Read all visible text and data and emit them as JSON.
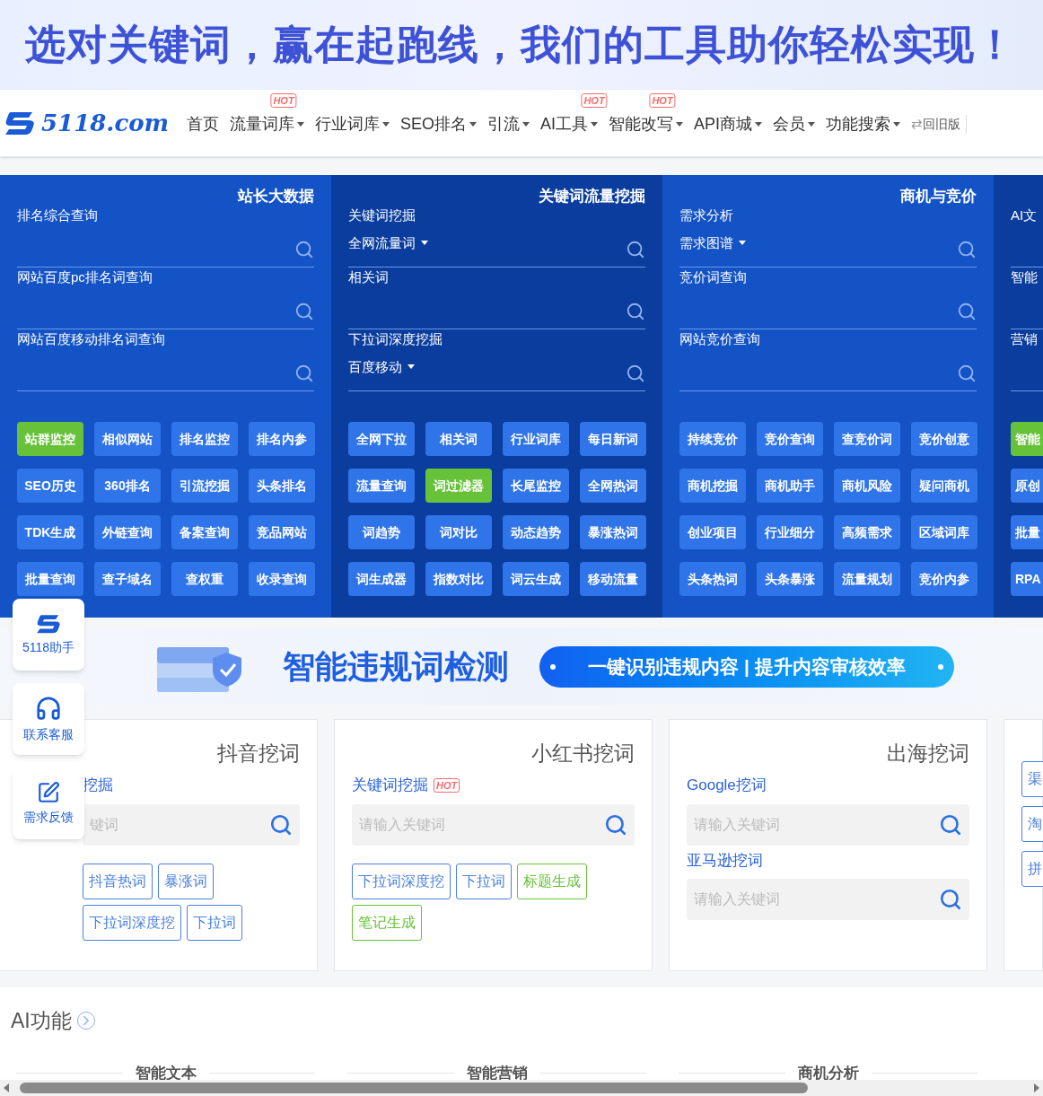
{
  "top_banner": {
    "headline": "选对关键词，赢在起跑线，我们的工具助你轻松实现！"
  },
  "nav": {
    "logo": "5118.com",
    "items": [
      {
        "label": "首页",
        "dropdown": false
      },
      {
        "label": "流量词库",
        "dropdown": true,
        "badge": "HOT"
      },
      {
        "label": "行业词库",
        "dropdown": true
      },
      {
        "label": "SEO排名",
        "dropdown": true
      },
      {
        "label": "引流",
        "dropdown": true
      },
      {
        "label": "AI工具",
        "dropdown": true,
        "badge": "HOT"
      },
      {
        "label": "智能改写",
        "dropdown": true,
        "badge": "HOT"
      },
      {
        "label": "API商城",
        "dropdown": true
      },
      {
        "label": "会员",
        "dropdown": true
      },
      {
        "label": "功能搜索",
        "dropdown": true
      }
    ],
    "switch_icon": "⇄",
    "old_version": "回旧版"
  },
  "tool_panel": {
    "columns": [
      {
        "title": "站长大数据",
        "searches": [
          {
            "label": "排名综合查询"
          },
          {
            "label": "网站百度pc排名词查询"
          },
          {
            "label": "网站百度移动排名词查询"
          }
        ],
        "buttons": [
          {
            "label": "站群监控",
            "highlighted": true
          },
          {
            "label": "相似网站",
            "highlighted": false
          },
          {
            "label": "排名监控",
            "highlighted": false
          },
          {
            "label": "排名内参",
            "highlighted": false
          },
          {
            "label": "SEO历史",
            "highlighted": false
          },
          {
            "label": "360排名",
            "highlighted": false
          },
          {
            "label": "引流挖掘",
            "highlighted": false
          },
          {
            "label": "头条排名",
            "highlighted": false
          },
          {
            "label": "TDK生成",
            "highlighted": false
          },
          {
            "label": "外链查询",
            "highlighted": false
          },
          {
            "label": "备案查询",
            "highlighted": false
          },
          {
            "label": "竞品网站",
            "highlighted": false
          },
          {
            "label": "批量查询",
            "highlighted": false
          },
          {
            "label": "查子域名",
            "highlighted": false
          },
          {
            "label": "查权重",
            "highlighted": false
          },
          {
            "label": "收录查询",
            "highlighted": false
          }
        ]
      },
      {
        "title": "关键词流量挖掘",
        "searches": [
          {
            "label": "关键词挖掘",
            "selector": "全网流量词"
          },
          {
            "label": "相关词"
          },
          {
            "label": "下拉词深度挖掘",
            "selector": "百度移动"
          }
        ],
        "buttons": [
          {
            "label": "全网下拉",
            "highlighted": false
          },
          {
            "label": "相关词",
            "highlighted": false
          },
          {
            "label": "行业词库",
            "highlighted": false
          },
          {
            "label": "每日新词",
            "highlighted": false
          },
          {
            "label": "流量查询",
            "highlighted": false
          },
          {
            "label": "词过滤器",
            "highlighted": true
          },
          {
            "label": "长尾监控",
            "highlighted": false
          },
          {
            "label": "全网热词",
            "highlighted": false
          },
          {
            "label": "词趋势",
            "highlighted": false
          },
          {
            "label": "词对比",
            "highlighted": false
          },
          {
            "label": "动态趋势",
            "highlighted": false
          },
          {
            "label": "暴涨热词",
            "highlighted": false
          },
          {
            "label": "词生成器",
            "highlighted": false
          },
          {
            "label": "指数对比",
            "highlighted": false
          },
          {
            "label": "词云生成",
            "highlighted": false
          },
          {
            "label": "移动流量",
            "highlighted": false
          }
        ]
      },
      {
        "title": "商机与竞价",
        "searches": [
          {
            "label": "需求分析",
            "selector": "需求图谱"
          },
          {
            "label": "竞价词查询"
          },
          {
            "label": "网站竞价查询"
          }
        ],
        "buttons": [
          {
            "label": "持续竞价",
            "highlighted": false
          },
          {
            "label": "竞价查询",
            "highlighted": false
          },
          {
            "label": "查竞价词",
            "highlighted": false
          },
          {
            "label": "竞价创意",
            "highlighted": false
          },
          {
            "label": "商机挖掘",
            "highlighted": false
          },
          {
            "label": "商机助手",
            "highlighted": false
          },
          {
            "label": "商机风险",
            "highlighted": false
          },
          {
            "label": "疑问商机",
            "highlighted": false
          },
          {
            "label": "创业项目",
            "highlighted": false
          },
          {
            "label": "行业细分",
            "highlighted": false
          },
          {
            "label": "高频需求",
            "highlighted": false
          },
          {
            "label": "区域词库",
            "highlighted": false
          },
          {
            "label": "头条热词",
            "highlighted": false
          },
          {
            "label": "头条暴涨",
            "highlighted": false
          },
          {
            "label": "流量规划",
            "highlighted": false
          },
          {
            "label": "竞价内参",
            "highlighted": false
          }
        ]
      },
      {
        "searches": [
          {
            "label": "AI文"
          },
          {
            "label": "智能"
          },
          {
            "label": "营销"
          }
        ],
        "buttons": [
          {
            "label": "智能",
            "highlighted": true
          },
          {
            "label": "原创",
            "highlighted": false
          },
          {
            "label": "批量",
            "highlighted": false
          },
          {
            "label": "RPA",
            "highlighted": false
          }
        ]
      }
    ]
  },
  "promo_banner": {
    "title": "智能违规词检测",
    "slogan": "一键识别违规内容 | 提升内容审核效率"
  },
  "cards": [
    {
      "title": "抖音挖词",
      "tools": [
        {
          "label": "挖掘",
          "placeholder": "键词"
        }
      ],
      "tags": [
        {
          "label": "抖音热词",
          "color": "#4a80e0"
        },
        {
          "label": "暴涨词",
          "color": "#4a80e0"
        },
        {
          "label": "下拉词深度挖",
          "color": "#4a80e0"
        },
        {
          "label": "下拉词",
          "color": "#4a80e0"
        }
      ]
    },
    {
      "title": "小红书挖词",
      "tools": [
        {
          "label": "关键词挖掘",
          "badge": "HOT",
          "placeholder": "请输入关键词"
        }
      ],
      "tags": [
        {
          "label": "下拉词深度挖",
          "color": "#4a80e0"
        },
        {
          "label": "下拉词",
          "color": "#4a80e0"
        },
        {
          "label": "标题生成",
          "color": "#67c23a"
        },
        {
          "label": "笔记生成",
          "color": "#67c23a"
        }
      ]
    },
    {
      "title": "出海挖词",
      "tools": [
        {
          "label": "Google挖词",
          "placeholder": "请输入关键词"
        },
        {
          "label": "亚马逊挖词",
          "placeholder": "请输入关键词"
        }
      ]
    },
    {
      "tags": [
        {
          "label": "渠",
          "color": "#4a80e0"
        },
        {
          "label": "淘",
          "color": "#4a80e0"
        },
        {
          "label": "拼",
          "color": "#4a80e0"
        }
      ]
    }
  ],
  "side_float": [
    {
      "label": "5118助手",
      "kind": "logo"
    },
    {
      "label": "联系客服",
      "kind": "headset"
    },
    {
      "label": "需求反馈",
      "kind": "edit"
    }
  ],
  "ai_section": {
    "title": "AI功能",
    "categories": [
      "智能文本",
      "智能营销",
      "商机分析"
    ]
  }
}
